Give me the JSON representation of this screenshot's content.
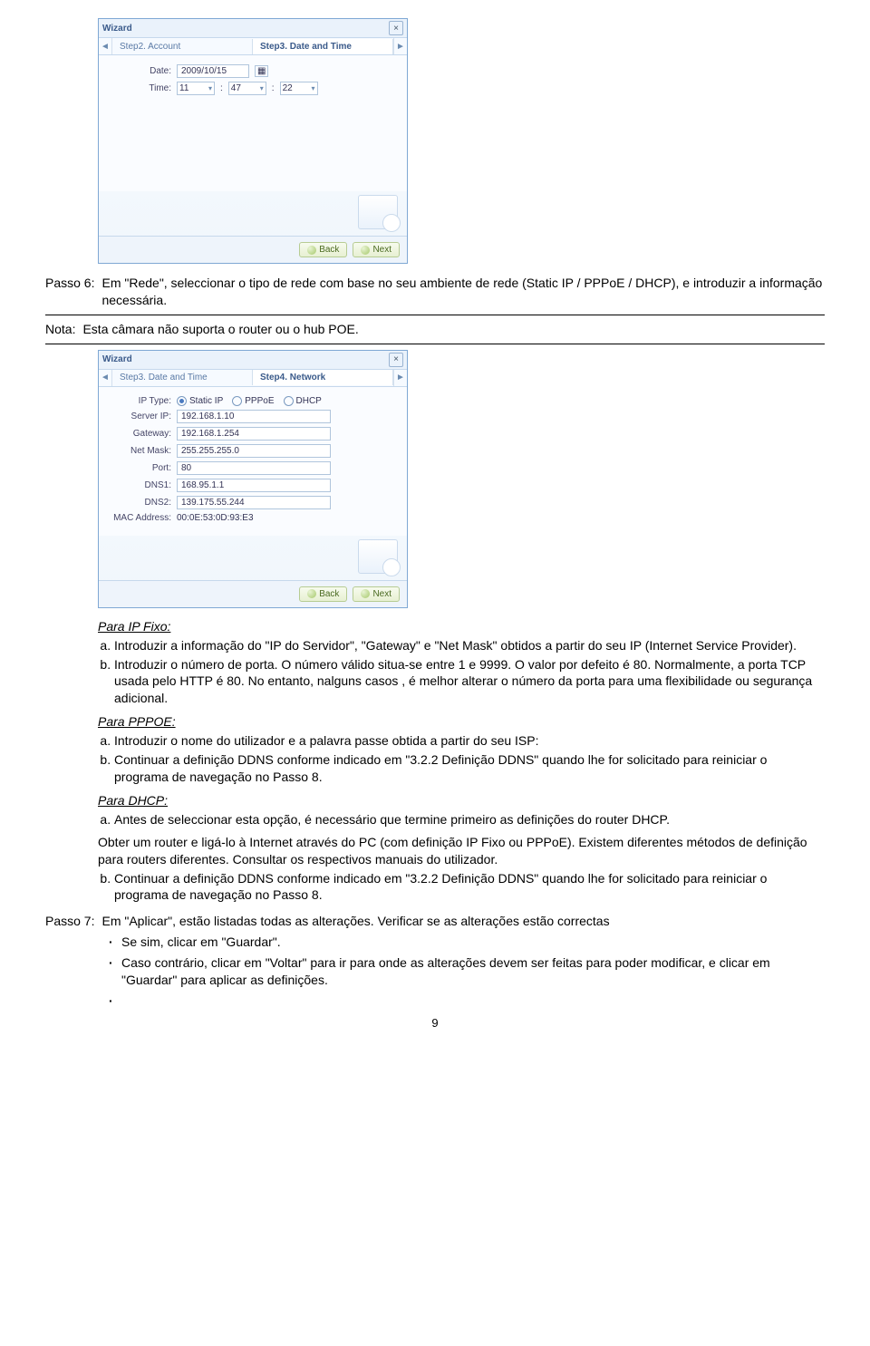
{
  "wizard1": {
    "title": "Wizard",
    "tab_prev": "Step2. Account",
    "tab_active": "Step3. Date and Time",
    "date_label": "Date:",
    "date_value": "2009/10/15",
    "time_label": "Time:",
    "time_h": "11",
    "time_m": "47",
    "time_s": "22",
    "back": "Back",
    "next": "Next"
  },
  "wizard2": {
    "title": "Wizard",
    "tab_prev": "Step3. Date and Time",
    "tab_active": "Step4. Network",
    "iptype_label": "IP Type:",
    "iptype_static": "Static IP",
    "iptype_pppoe": "PPPoE",
    "iptype_dhcp": "DHCP",
    "serverip_label": "Server IP:",
    "serverip": "192.168.1.10",
    "gateway_label": "Gateway:",
    "gateway": "192.168.1.254",
    "netmask_label": "Net Mask:",
    "netmask": "255.255.255.0",
    "port_label": "Port:",
    "port": "80",
    "dns1_label": "DNS1:",
    "dns1": "168.95.1.1",
    "dns2_label": "DNS2:",
    "dns2": "139.175.55.244",
    "mac_label": "MAC Address:",
    "mac": "00:0E:53:0D:93:E3",
    "back": "Back",
    "next": "Next"
  },
  "step6": {
    "label": "Passo 6:",
    "text": "Em \"Rede\", seleccionar o tipo de rede com base no seu ambiente de rede (Static IP / PPPoE / DHCP), e introduzir a informação necessária."
  },
  "nota": {
    "label": "Nota:",
    "text": "Esta câmara não suporta o router ou o hub POE."
  },
  "ipfixo": {
    "title": "Para IP Fixo:",
    "a": "Introduzir a informação do \"IP do Servidor\", \"Gateway\" e \"Net Mask\" obtidos a partir do seu IP (Internet Service Provider).",
    "b": "Introduzir o número de porta. O número válido situa-se entre 1 e 9999. O valor por defeito é 80. Normalmente, a porta TCP usada pelo HTTP é 80. No entanto, nalguns casos , é melhor alterar o número da porta para uma flexibilidade ou segurança adicional."
  },
  "pppoe": {
    "title": "Para PPPOE:",
    "a": "Introduzir o nome do utilizador e a palavra passe obtida a partir do seu ISP:",
    "b": "Continuar a definição DDNS conforme indicado em \"3.2.2 Definição DDNS\" quando lhe for solicitado para reiniciar o programa de navegação no Passo 8."
  },
  "dhcp": {
    "title": "Para DHCP:",
    "a": "Antes de seleccionar esta opção, é necessário que termine primeiro as definições do router DHCP.",
    "p1": "Obter um router e ligá-lo à Internet através do PC (com definição IP Fixo ou PPPoE). Existem diferentes métodos de definição para routers diferentes. Consultar os respectivos manuais do utilizador.",
    "b": "Continuar a definição DDNS conforme indicado em \"3.2.2 Definição DDNS\" quando lhe for solicitado para reiniciar o programa de navegação no Passo 8."
  },
  "step7": {
    "label": "Passo 7:",
    "text": "Em \"Aplicar\", estão listadas todas as alterações. Verificar se as alterações estão correctas",
    "bul1": "Se sim, clicar em \"Guardar\".",
    "bul2": "Caso contrário, clicar em \"Voltar\" para ir para onde as alterações devem ser feitas para poder modificar, e clicar em \"Guardar\" para aplicar as definições."
  },
  "pagenum": "9"
}
